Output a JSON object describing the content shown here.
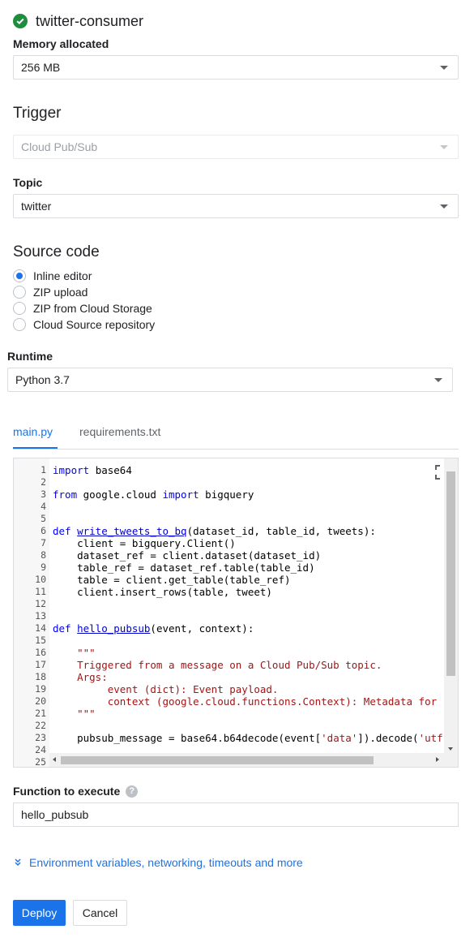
{
  "header": {
    "name": "twitter-consumer"
  },
  "memory": {
    "label": "Memory allocated",
    "value": "256 MB"
  },
  "trigger": {
    "title": "Trigger",
    "value": "Cloud Pub/Sub"
  },
  "topic": {
    "label": "Topic",
    "value": "twitter"
  },
  "source": {
    "title": "Source code",
    "options": [
      {
        "label": "Inline editor",
        "selected": true
      },
      {
        "label": "ZIP upload",
        "selected": false
      },
      {
        "label": "ZIP from Cloud Storage",
        "selected": false
      },
      {
        "label": "Cloud Source repository",
        "selected": false
      }
    ]
  },
  "runtime": {
    "label": "Runtime",
    "value": "Python 3.7"
  },
  "tabs": [
    {
      "label": "main.py",
      "active": true
    },
    {
      "label": "requirements.txt",
      "active": false
    }
  ],
  "editor": {
    "lines": [
      "import base64",
      "",
      "from google.cloud import bigquery",
      "",
      "",
      "def write_tweets_to_bq(dataset_id, table_id, tweets):",
      "    client = bigquery.Client()",
      "    dataset_ref = client.dataset(dataset_id)",
      "    table_ref = dataset_ref.table(table_id)",
      "    table = client.get_table(table_ref)",
      "    client.insert_rows(table, tweet)",
      "",
      "",
      "def hello_pubsub(event, context):",
      "",
      "    \"\"\"",
      "    Triggered from a message on a Cloud Pub/Sub topic.",
      "    Args:",
      "         event (dict): Event payload.",
      "         context (google.cloud.functions.Context): Metadata for",
      "    \"\"\"",
      "",
      "    pubsub_message = base64.b64decode(event['data']).decode('utf",
      "",
      ""
    ]
  },
  "function": {
    "label": "Function to execute",
    "value": "hello_pubsub"
  },
  "more_link": "Environment variables, networking, timeouts and more",
  "buttons": {
    "deploy": "Deploy",
    "cancel": "Cancel"
  },
  "colors": {
    "accent": "#1a73e8",
    "success": "#1e8e3e"
  },
  "icons": [
    "check-circle-icon",
    "caret-down-icon",
    "fullscreen-icon",
    "help-icon",
    "chevron-double-down-icon"
  ]
}
